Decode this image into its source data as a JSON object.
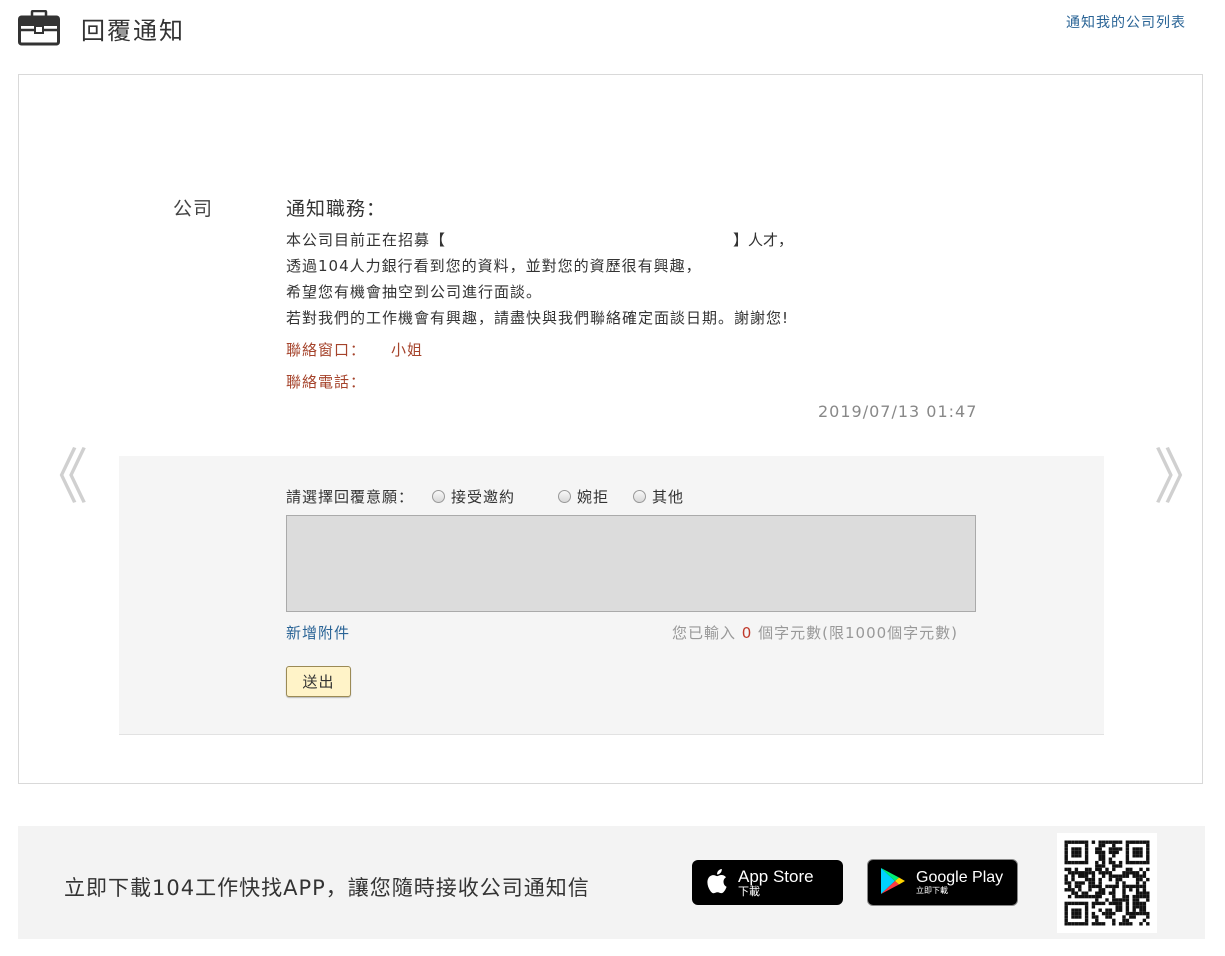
{
  "header": {
    "title": "回覆通知",
    "icon": "briefcase-icon",
    "company_list_link": "通知我的公司列表"
  },
  "notice": {
    "company_label": "公司",
    "job_label": "通知職務：",
    "line1_prefix": "本公司目前正在招募【",
    "line1_suffix": "】人才，",
    "line2": "透過104人力銀行看到您的資料，並對您的資歷很有興趣，",
    "line3": "希望您有機會抽空到公司進行面談。",
    "line4": "若對我們的工作機會有興趣，請盡快與我們聯絡確定面談日期。謝謝您!",
    "contact_window_label": "聯絡窗口：",
    "contact_name": "小姐",
    "contact_phone_label": "聯絡電話：",
    "datetime": "2019/07/13 01:47"
  },
  "nav": {
    "prev": "《",
    "next": "》"
  },
  "reply": {
    "prompt": "請選擇回覆意願：",
    "options": [
      "接受邀約",
      "婉拒",
      "其他"
    ],
    "textarea_value": "",
    "add_attachment": "新增附件",
    "counter_prefix": "您已輸入",
    "counter_value": "0",
    "counter_suffix": "個字元數(限1000個字元數)",
    "submit": "送出"
  },
  "footer": {
    "text": "立即下載104工作快找APP，讓您隨時接收公司通知信",
    "app_store": {
      "big": "App Store",
      "small": "下載"
    },
    "google_play": {
      "big": "Google Play",
      "small": "立即下載"
    }
  },
  "colors": {
    "link": "#2a6496",
    "contact": "#a5432b",
    "counter_number": "#c0392b",
    "submit_bg": "#fff3c8"
  }
}
